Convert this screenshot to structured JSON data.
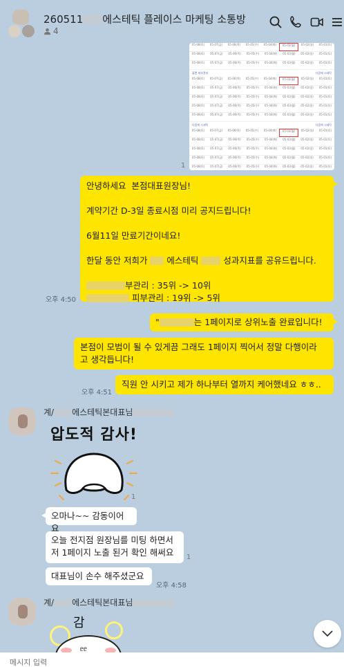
{
  "header": {
    "room_title_prefix": "260511",
    "room_title_suffix": "에스테틱 플레이스 마케팅 소통방",
    "member_count": "4",
    "icons": [
      "search-icon",
      "phone-icon",
      "video-icon",
      "menu-icon"
    ]
  },
  "messages": {
    "m1_lines": [
      "안녕하세요  본점대표원장님!",
      "",
      "계약기간 D-3일 종료시점 미리 공지드립니다!",
      "",
      "6월11일 만료기간이네요!",
      "",
      "한달 동안 저희가",
      "에스테틱",
      "성과지표를 공유드립니다.",
      "부관리 : 35위 -> 10위",
      "피부관리 : 19위 -> 5위"
    ],
    "m1_time": "오후 4:50",
    "m2_text": "는 1페이지로 상위노출 완료입니다!",
    "m2_prefix": "\"",
    "m3_text": "본점이 모범이 될 수 있게끔 그래도 1페이지 찍어서 정말 다행이라\n고 생각듭니다!",
    "m4_text": "직원 안 시키고 제가 하나부터 열까지 케어했네요 ㅎㅎ..",
    "m4_time": "오후 4:51",
    "sender1_prefix": "계/",
    "sender1_suffix": "에스테틱본대표님",
    "sticker1_text": "압도적 감사!",
    "r1_text": "오마나~~ 감동이어요",
    "r2_text": "오늘 전지점 원장님를 미팅 하면서\n저 1페이지 노출 된거 확인 해써요",
    "r3_text": "대표님이 손수 해주셨군요",
    "r3_time": "오후 4:58",
    "sender2_prefix": "계/",
    "sender2_suffix": "에스테틱본대표님",
    "sticker2_text": "감",
    "unread_mark": "1"
  },
  "calendar": {
    "section_labels": [
      "플랜 피부관리",
      "다음에 시세탁",
      "다음에 시세탁"
    ],
    "dates": [
      "05-08(토)",
      "05-07(금)",
      "05-06(목)",
      "05-05(수)",
      "05-04(화)",
      "05-03(월)",
      "05-02(일)",
      "05-01(토)"
    ]
  },
  "input": {
    "placeholder": "메시지 입력"
  },
  "colors": {
    "background": "#bacee0",
    "my_bubble": "#fee500",
    "their_bubble": "#ffffff"
  }
}
